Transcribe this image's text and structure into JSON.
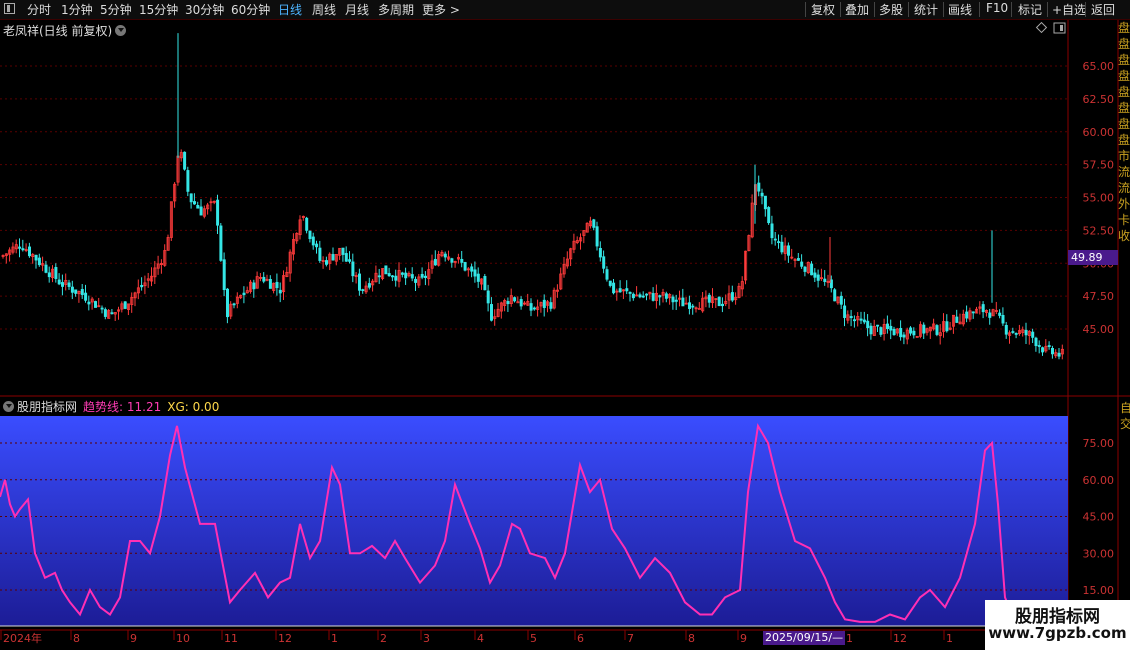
{
  "toolbar": {
    "periods": [
      "分时",
      "1分钟",
      "5分钟",
      "15分钟",
      "30分钟",
      "60分钟",
      "日线",
      "周线",
      "月线",
      "多周期",
      "更多 >"
    ],
    "active_period": "日线",
    "right_buttons": [
      "复权",
      "叠加",
      "多股",
      "统计",
      "画线",
      "F10",
      "标记",
      "+自选",
      "返回"
    ]
  },
  "main_chart": {
    "title": "老凤祥(日线 前复权)",
    "current_price_tag": "49.89",
    "price_axis": [
      "65.00",
      "62.50",
      "60.00",
      "57.50",
      "55.00",
      "52.50",
      "50.00",
      "47.50",
      "45.00"
    ]
  },
  "indicator": {
    "name": "股朋指标网",
    "trend_label": "趋势线: 11.21",
    "xg_label": "XG: 0.00",
    "axis": [
      "75.00",
      "60.00",
      "45.00",
      "30.00",
      "15.00"
    ]
  },
  "x_axis": {
    "labels": [
      "2024年",
      "8",
      "9",
      "10",
      "11",
      "12",
      "1",
      "2",
      "3",
      "4",
      "5",
      "6",
      "7",
      "8",
      "9",
      "1",
      "12",
      "1"
    ],
    "cursor_date": "2025/09/15/—"
  },
  "right_panel_chars": [
    "盘",
    "盘",
    "盘",
    "盘",
    "盘",
    "盘",
    "盘",
    "盘",
    "市",
    "流",
    "流",
    "外",
    "卡",
    "收",
    "自",
    "交"
  ],
  "watermark": {
    "line1": "股朋指标网",
    "line2": "www.7gpzb.com"
  },
  "colors": {
    "up": "#ff3b3b",
    "down": "#35e6e6",
    "trend_line": "#ff2fb4",
    "osc_top": "#3a4dff",
    "osc_bottom": "#1c1c96",
    "active_tab": "#4db4ff"
  }
}
